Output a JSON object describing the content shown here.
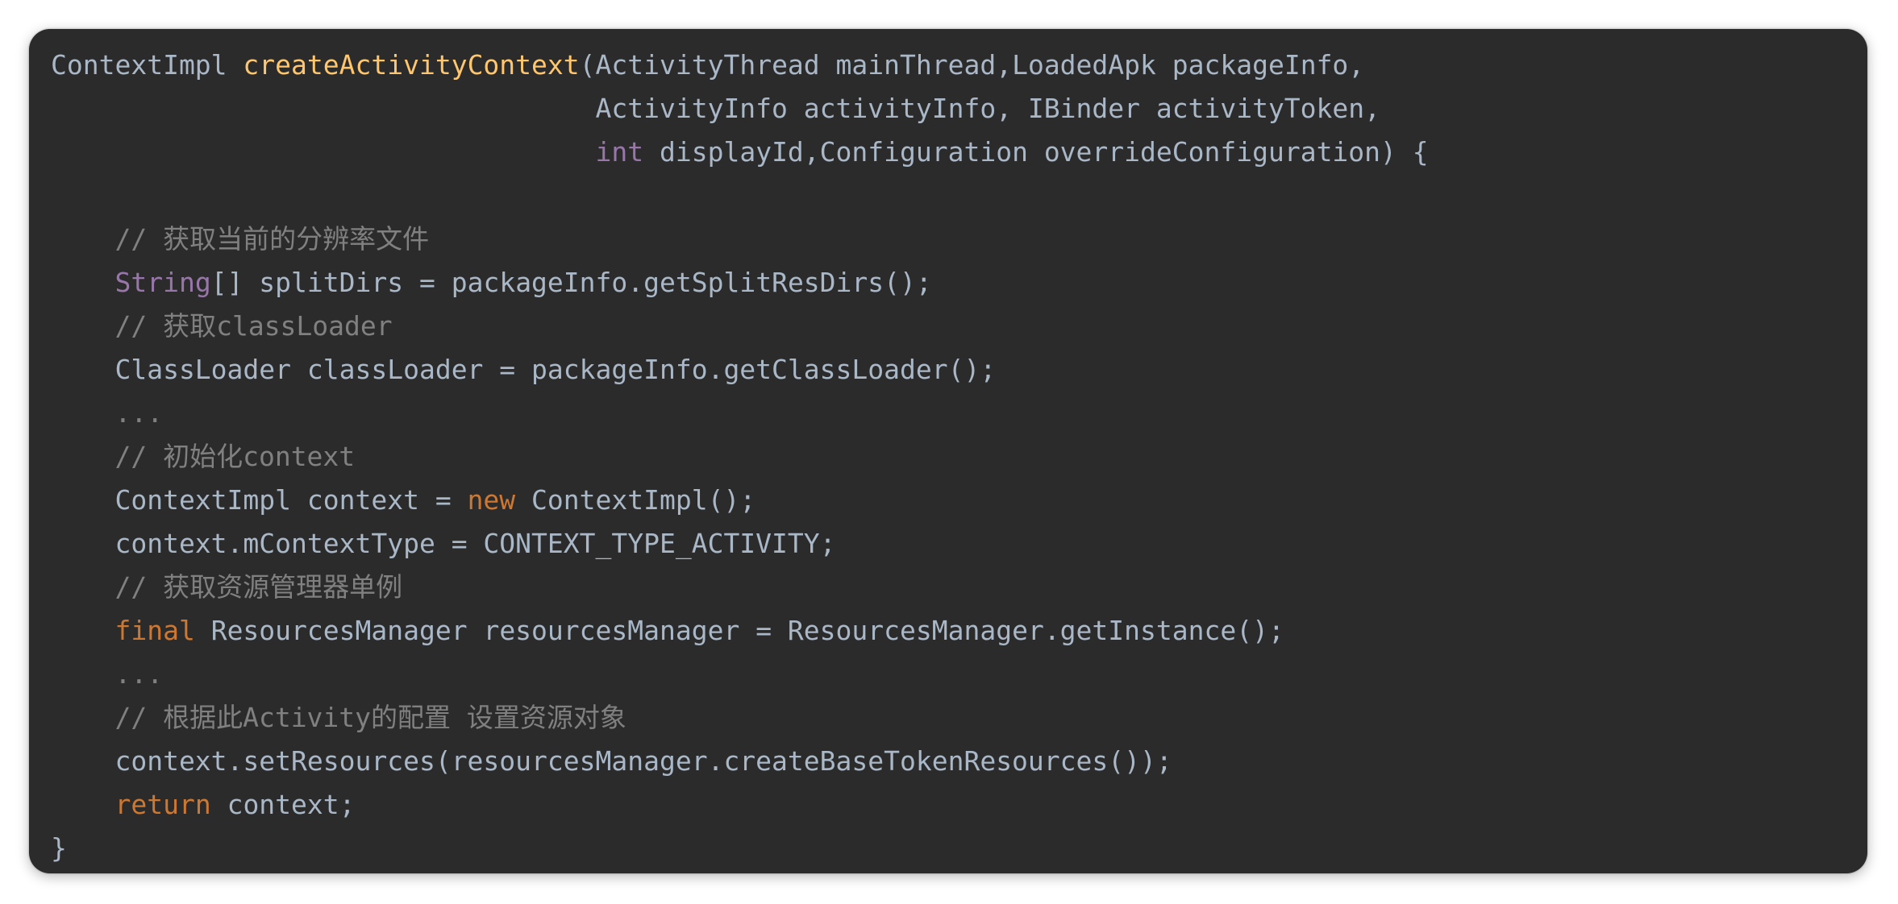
{
  "colors": {
    "background": "#ffffff",
    "editor_background": "#2b2b2b",
    "plain": "#a9b7c6",
    "function": "#ffc66d",
    "keyword": "#cc7832",
    "type_keyword": "#9876aa",
    "comment": "#808080"
  },
  "code": {
    "lines": [
      [
        {
          "k": "plain",
          "t": "ContextImpl "
        },
        {
          "k": "fn",
          "t": "createActivityContext"
        },
        {
          "k": "plain",
          "t": "(ActivityThread mainThread,LoadedApk packageInfo,"
        }
      ],
      [
        {
          "k": "plain",
          "t": "                                  ActivityInfo activityInfo, IBinder activityToken,"
        }
      ],
      [
        {
          "k": "plain",
          "t": "                                  "
        },
        {
          "k": "type",
          "t": "int"
        },
        {
          "k": "plain",
          "t": " displayId,Configuration overrideConfiguration) {"
        }
      ],
      [
        {
          "k": "plain",
          "t": ""
        }
      ],
      [
        {
          "k": "plain",
          "t": "    "
        },
        {
          "k": "comment",
          "t": "// 获取当前的分辨率文件"
        }
      ],
      [
        {
          "k": "plain",
          "t": "    "
        },
        {
          "k": "type",
          "t": "String"
        },
        {
          "k": "plain",
          "t": "[] splitDirs = packageInfo.getSplitResDirs();"
        }
      ],
      [
        {
          "k": "plain",
          "t": "    "
        },
        {
          "k": "comment",
          "t": "// 获取classLoader"
        }
      ],
      [
        {
          "k": "plain",
          "t": "    ClassLoader classLoader = packageInfo.getClassLoader();"
        }
      ],
      [
        {
          "k": "plain",
          "t": "    "
        },
        {
          "k": "comment",
          "t": "..."
        }
      ],
      [
        {
          "k": "plain",
          "t": "    "
        },
        {
          "k": "comment",
          "t": "// 初始化context"
        }
      ],
      [
        {
          "k": "plain",
          "t": "    ContextImpl context = "
        },
        {
          "k": "kw",
          "t": "new"
        },
        {
          "k": "plain",
          "t": " ContextImpl();"
        }
      ],
      [
        {
          "k": "plain",
          "t": "    context.mContextType = CONTEXT_TYPE_ACTIVITY;"
        }
      ],
      [
        {
          "k": "plain",
          "t": "    "
        },
        {
          "k": "comment",
          "t": "// 获取资源管理器单例"
        }
      ],
      [
        {
          "k": "plain",
          "t": "    "
        },
        {
          "k": "kw",
          "t": "final"
        },
        {
          "k": "plain",
          "t": " ResourcesManager resourcesManager = ResourcesManager.getInstance();"
        }
      ],
      [
        {
          "k": "plain",
          "t": "    "
        },
        {
          "k": "comment",
          "t": "..."
        }
      ],
      [
        {
          "k": "plain",
          "t": "    "
        },
        {
          "k": "comment",
          "t": "// 根据此Activity的配置 设置资源对象"
        }
      ],
      [
        {
          "k": "plain",
          "t": "    context.setResources(resourcesManager.createBaseTokenResources());"
        }
      ],
      [
        {
          "k": "plain",
          "t": "    "
        },
        {
          "k": "kw",
          "t": "return"
        },
        {
          "k": "plain",
          "t": " context;"
        }
      ],
      [
        {
          "k": "plain",
          "t": "}"
        }
      ]
    ]
  }
}
